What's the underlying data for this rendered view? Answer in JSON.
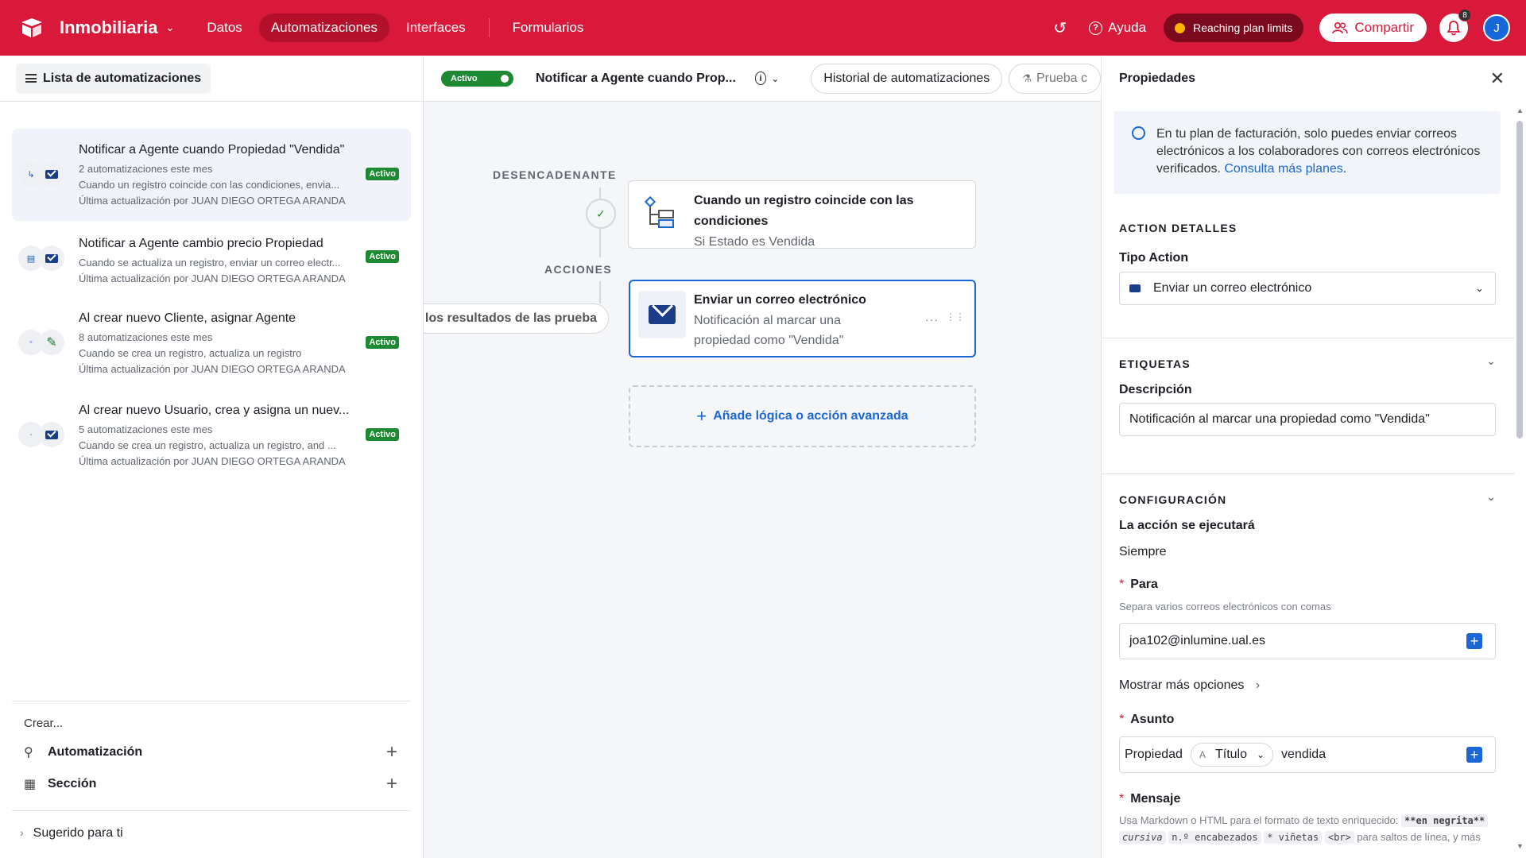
{
  "topbar": {
    "base_name": "Inmobiliaria",
    "nav": [
      "Datos",
      "Automatizaciones",
      "Interfaces",
      "Formularios"
    ],
    "help": "Ayuda",
    "plan_pill": "Reaching plan limits",
    "share": "Compartir",
    "notifications": "8",
    "avatar_initial": "J"
  },
  "left": {
    "list_button": "Lista de automatizaciones",
    "automations": [
      {
        "title": "Notificar a Agente cuando Propiedad \"Vendida\"",
        "runs": "2 automatizaciones este mes",
        "desc": "Cuando un registro coincide con las condiciones, envia...",
        "updated": "Última actualización por JUAN DIEGO ORTEGA ARANDA",
        "status": "Activo"
      },
      {
        "title": "Notificar a Agente cambio precio Propiedad",
        "runs": "",
        "desc": "Cuando se actualiza un registro, enviar un correo electr...",
        "updated": "Última actualización por JUAN DIEGO ORTEGA ARANDA",
        "status": "Activo"
      },
      {
        "title": "Al crear nuevo Cliente, asignar Agente",
        "runs": "8 automatizaciones este mes",
        "desc": "Cuando se crea un registro, actualiza un registro",
        "updated": "Última actualización por JUAN DIEGO ORTEGA ARANDA",
        "status": "Activo"
      },
      {
        "title": "Al crear nuevo Usuario, crea y asigna un nuev...",
        "runs": "5 automatizaciones este mes",
        "desc": "Cuando se crea un registro, actualiza un registro, and ...",
        "updated": "Última actualización por JUAN DIEGO ORTEGA ARANDA",
        "status": "Activo"
      }
    ],
    "create_label": "Crear...",
    "create_automation": "Automatización",
    "create_section": "Sección",
    "suggested": "Sugerido para ti"
  },
  "canvas": {
    "toggle_label": "Activo",
    "title": "Notificar a Agente cuando Prop...",
    "history_button": "Historial de automatizaciones",
    "test_button": "Prueba c",
    "trigger_label": "DESENCADENANTE",
    "actions_label": "ACCIONES",
    "trigger_title": "Cuando un registro coincide con las condiciones",
    "trigger_sub": "Si Estado es Vendida",
    "action_title": "Enviar un correo electrónico",
    "action_sub": "Notificación al marcar una propiedad como \"Vendida\"",
    "results_pill": "Usar los resultados de las prueba",
    "add_logic": "Añade lógica o acción avanzada"
  },
  "right": {
    "title": "Propiedades",
    "info_text": "En tu plan de facturación, solo puedes enviar correos electrónicos a los colaboradores con correos electrónicos verificados.",
    "info_link": "Consulta más planes",
    "action_details": "ACTION DETALLES",
    "action_type_label": "Tipo Action",
    "action_type_value": "Enviar un correo electrónico",
    "tags_section": "ETIQUETAS",
    "description_label": "Descripción",
    "description_value": "Notificación al marcar una propiedad como \"Vendida\"",
    "config_section": "CONFIGURACIÓN",
    "run_label": "La acción se ejecutará",
    "run_value": "Siempre",
    "to_label": "Para",
    "to_hint": "Separa varios correos electrónicos con comas",
    "to_value": "joa102@inlumine.ual.es",
    "more_options": "Mostrar más opciones",
    "subject_label": "Asunto",
    "subject_prefix": "Propiedad",
    "subject_token": "Título",
    "subject_suffix": "vendida",
    "message_label": "Mensaje",
    "md_line1": "Usa Markdown o HTML para el formato de texto enriquecido:",
    "md_bold": "**en negrita**",
    "md_italic": "cursiva",
    "md_headers": "n.º encabezados",
    "md_bullets": "* viñetas",
    "md_br": "<br>",
    "md_tail": "para saltos de línea, y más"
  }
}
